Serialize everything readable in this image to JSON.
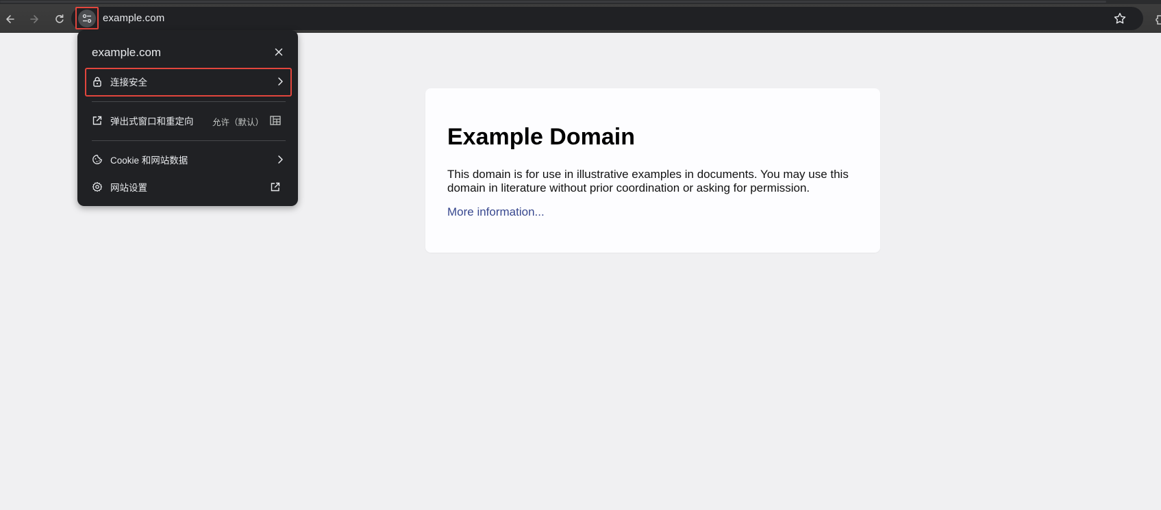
{
  "browser": {
    "url": "example.com",
    "icons": {
      "back": "arrow-back-icon",
      "forward": "arrow-forward-icon",
      "reload": "reload-icon",
      "site_info": "tune-icon",
      "bookmark": "star-icon"
    }
  },
  "page": {
    "heading": "Example Domain",
    "body": "This domain is for use in illustrative examples in documents. You may use this domain in literature without prior coordination or asking for permission.",
    "link": "More information..."
  },
  "site_info_popup": {
    "title": "example.com",
    "items": [
      {
        "label": "连接安全",
        "icon": "lock-icon",
        "trailing": "chevron-right-icon"
      },
      {
        "label": "弹出式窗口和重定向",
        "icon": "open-in-new-icon",
        "value": "允许（默认）",
        "trailing": "blocked-icon"
      },
      {
        "label": "Cookie 和网站数据",
        "icon": "cookie-icon",
        "trailing": "chevron-right-icon"
      },
      {
        "label": "网站设置",
        "icon": "gear-icon",
        "trailing": "open-in-new-icon"
      }
    ]
  },
  "colors": {
    "highlight": "#e3463d",
    "popup_bg": "#202124",
    "toolbar_bg": "#3c3c3c",
    "page_bg": "#f0f0f2",
    "link": "#38488f"
  }
}
